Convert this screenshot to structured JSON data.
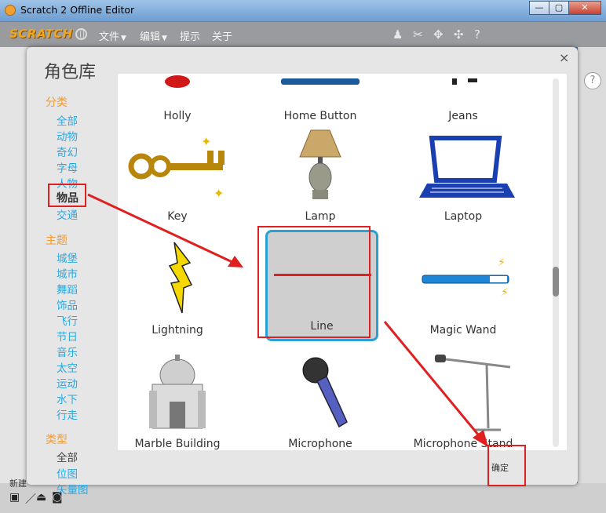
{
  "window": {
    "title": "Scratch 2 Offline Editor"
  },
  "menubar": {
    "logo": "SCRATCH",
    "items": [
      {
        "label": "文件"
      },
      {
        "label": "编辑"
      },
      {
        "label": "提示"
      },
      {
        "label": "关于"
      }
    ]
  },
  "dialog": {
    "title": "角色库",
    "close": "×",
    "ok_label": "确定",
    "categories_heading": "分类",
    "categories": [
      "全部",
      "动物",
      "奇幻",
      "字母",
      "人物",
      "物品",
      "交通"
    ],
    "themes_heading": "主题",
    "themes": [
      "城堡",
      "城市",
      "舞蹈",
      "饰品",
      "飞行",
      "节日",
      "音乐",
      "太空",
      "运动",
      "水下",
      "行走"
    ],
    "types_heading": "类型",
    "types": [
      "全部",
      "位图",
      "矢量图"
    ],
    "selected_category": "物品",
    "items": [
      {
        "name": "Holly"
      },
      {
        "name": "Home Button"
      },
      {
        "name": "Jeans"
      },
      {
        "name": "Key"
      },
      {
        "name": "Lamp"
      },
      {
        "name": "Laptop"
      },
      {
        "name": "Lightning"
      },
      {
        "name": "Line"
      },
      {
        "name": "Magic Wand"
      },
      {
        "name": "Marble Building"
      },
      {
        "name": "Microphone"
      },
      {
        "name": "Microphone Stand"
      }
    ]
  },
  "background": {
    "help": "?",
    "new_label": "新建"
  },
  "colors": {
    "accent_orange": "#f29a2e",
    "link_blue": "#2aa8e0",
    "selection_blue": "#2ba0d8",
    "annotation_red": "#e02020"
  }
}
